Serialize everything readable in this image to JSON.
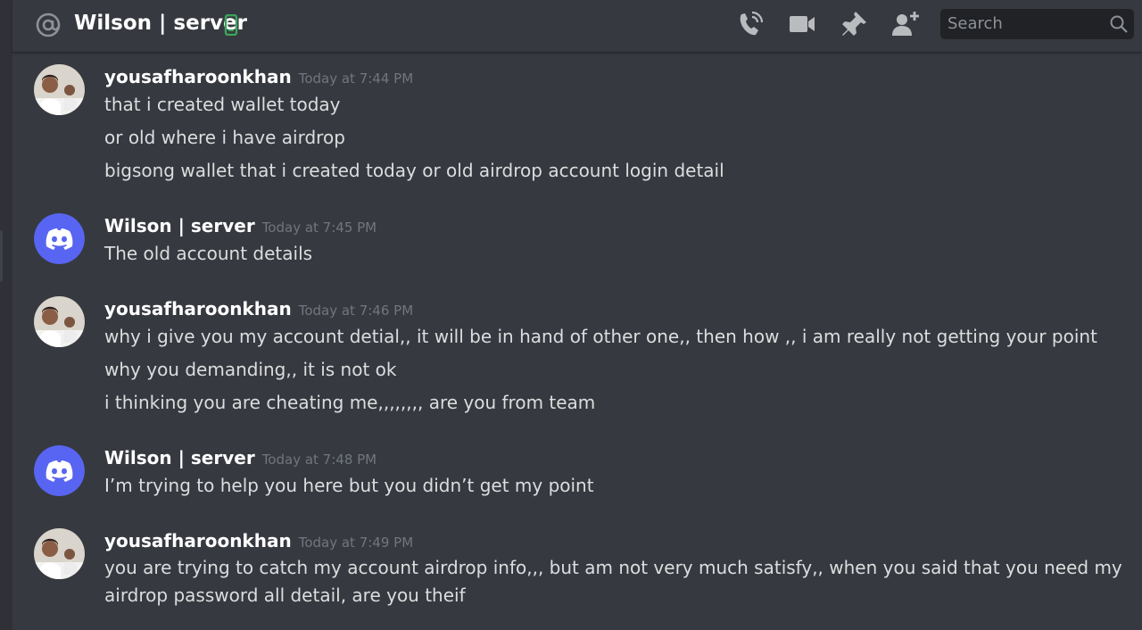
{
  "header": {
    "title": "Wilson | server",
    "search_placeholder": "Search",
    "icons": [
      "at-icon",
      "mobile-phone-icon",
      "voice-call-icon",
      "video-call-icon",
      "pin-icon",
      "add-member-icon",
      "search-icon"
    ],
    "accent_online": "#3ba55c"
  },
  "messages": [
    {
      "author": "yousafharoonkhan",
      "timestamp": "Today at 7:44 PM",
      "lines": [
        "that i created wallet today",
        "or old where i have airdrop",
        "bigsong wallet that i created today or old airdrop account login detail"
      ]
    },
    {
      "author": "Wilson | server",
      "timestamp": "Today at 7:45 PM",
      "lines": [
        "The old account details"
      ]
    },
    {
      "author": "yousafharoonkhan",
      "timestamp": "Today at 7:46 PM",
      "lines": [
        "why i give you my account detial,, it  will be in hand of other one,, then how ,, i am really not getting your point",
        "why you demanding,, it is not ok",
        "i thinking you are cheating me,,,,,,,, are you from team"
      ]
    },
    {
      "author": "Wilson | server",
      "timestamp": "Today at 7:48 PM",
      "lines": [
        "I’m trying to help you here but you didn’t get my point"
      ]
    },
    {
      "author": "yousafharoonkhan",
      "timestamp": "Today at 7:49 PM",
      "lines": [
        "you are trying to catch my account airdrop info,,, but  am not very much satisfy,, when you said that you need my airdrop password all detail, are you theif"
      ]
    }
  ],
  "colors": {
    "background": "#36393f",
    "discord_blurple": "#5865f2",
    "text": "#dcddde",
    "timestamp": "#72767d"
  }
}
